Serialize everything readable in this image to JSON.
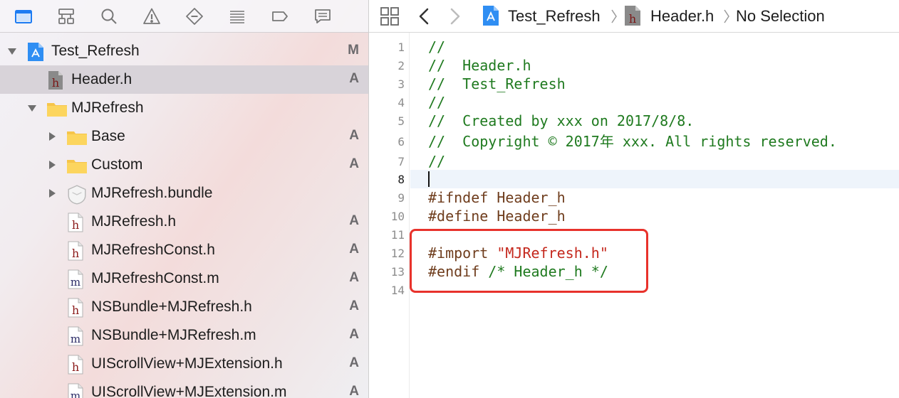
{
  "navigator": {
    "toolbar_icons": [
      "folder-icon",
      "hierarchy-icon",
      "search-icon",
      "warning-icon",
      "test-diamond-icon",
      "debug-list-icon",
      "breakpoint-icon",
      "report-icon"
    ],
    "items": [
      {
        "label": "Test_Refresh",
        "badge": "M",
        "icon": "project-icon",
        "disclosure": "open",
        "indent": 0,
        "selected": false
      },
      {
        "label": "Header.h",
        "badge": "A",
        "icon": "header-file-icon",
        "disclosure": "none",
        "indent": 1,
        "selected": true
      },
      {
        "label": "MJRefresh",
        "badge": "",
        "icon": "folder-icon",
        "disclosure": "open",
        "indent": 1,
        "selected": false
      },
      {
        "label": "Base",
        "badge": "A",
        "icon": "folder-icon",
        "disclosure": "closed",
        "indent": 2,
        "selected": false
      },
      {
        "label": "Custom",
        "badge": "A",
        "icon": "folder-icon",
        "disclosure": "closed",
        "indent": 2,
        "selected": false
      },
      {
        "label": "MJRefresh.bundle",
        "badge": "",
        "icon": "bundle-icon",
        "disclosure": "closed",
        "indent": 2,
        "selected": false
      },
      {
        "label": "MJRefresh.h",
        "badge": "A",
        "icon": "header-file-icon",
        "disclosure": "none",
        "indent": 2,
        "selected": false
      },
      {
        "label": "MJRefreshConst.h",
        "badge": "A",
        "icon": "header-file-icon",
        "disclosure": "none",
        "indent": 2,
        "selected": false
      },
      {
        "label": "MJRefreshConst.m",
        "badge": "A",
        "icon": "implementation-file-icon",
        "disclosure": "none",
        "indent": 2,
        "selected": false
      },
      {
        "label": "NSBundle+MJRefresh.h",
        "badge": "A",
        "icon": "header-file-icon",
        "disclosure": "none",
        "indent": 2,
        "selected": false
      },
      {
        "label": "NSBundle+MJRefresh.m",
        "badge": "A",
        "icon": "implementation-file-icon",
        "disclosure": "none",
        "indent": 2,
        "selected": false
      },
      {
        "label": "UIScrollView+MJExtension.h",
        "badge": "A",
        "icon": "header-file-icon",
        "disclosure": "none",
        "indent": 2,
        "selected": false
      },
      {
        "label": "UIScrollView+MJExtension.m",
        "badge": "A",
        "icon": "implementation-file-icon",
        "disclosure": "none",
        "indent": 2,
        "selected": false
      }
    ]
  },
  "jump_bar": {
    "crumbs": [
      "Test_Refresh",
      "Header.h",
      "No Selection"
    ]
  },
  "editor": {
    "current_line": 8,
    "lines": [
      {
        "no": "1",
        "segments": [
          {
            "t": "//",
            "c": "comment"
          }
        ]
      },
      {
        "no": "2",
        "segments": [
          {
            "t": "//  Header.h",
            "c": "comment"
          }
        ]
      },
      {
        "no": "3",
        "segments": [
          {
            "t": "//  Test_Refresh",
            "c": "comment"
          }
        ]
      },
      {
        "no": "4",
        "segments": [
          {
            "t": "//",
            "c": "comment"
          }
        ]
      },
      {
        "no": "5",
        "segments": [
          {
            "t": "//  Created by xxx on 2017/8/8.",
            "c": "comment"
          }
        ]
      },
      {
        "no": "6",
        "segments": [
          {
            "t": "//  Copyright © 2017年 xxx. All rights reserved.",
            "c": "comment"
          }
        ]
      },
      {
        "no": "7",
        "segments": [
          {
            "t": "//",
            "c": "comment"
          }
        ]
      },
      {
        "no": "8",
        "segments": []
      },
      {
        "no": "9",
        "segments": [
          {
            "t": "#ifndef Header_h",
            "c": "prep"
          }
        ]
      },
      {
        "no": "10",
        "segments": [
          {
            "t": "#define Header_h",
            "c": "prep"
          }
        ]
      },
      {
        "no": "11",
        "segments": []
      },
      {
        "no": "12",
        "segments": [
          {
            "t": "#import ",
            "c": "prep"
          },
          {
            "t": "\"MJRefresh.h\"",
            "c": "string"
          }
        ]
      },
      {
        "no": "13",
        "segments": [
          {
            "t": "#endif ",
            "c": "prep"
          },
          {
            "t": "/* Header_h */",
            "c": "comment"
          }
        ]
      },
      {
        "no": "14",
        "segments": []
      }
    ]
  },
  "colors": {
    "comment": "#1f7a1f",
    "preprocessor": "#6f3d1d",
    "string": "#c4271c",
    "annotation_box": "#e8322b",
    "selection": "#d8d3d9"
  }
}
